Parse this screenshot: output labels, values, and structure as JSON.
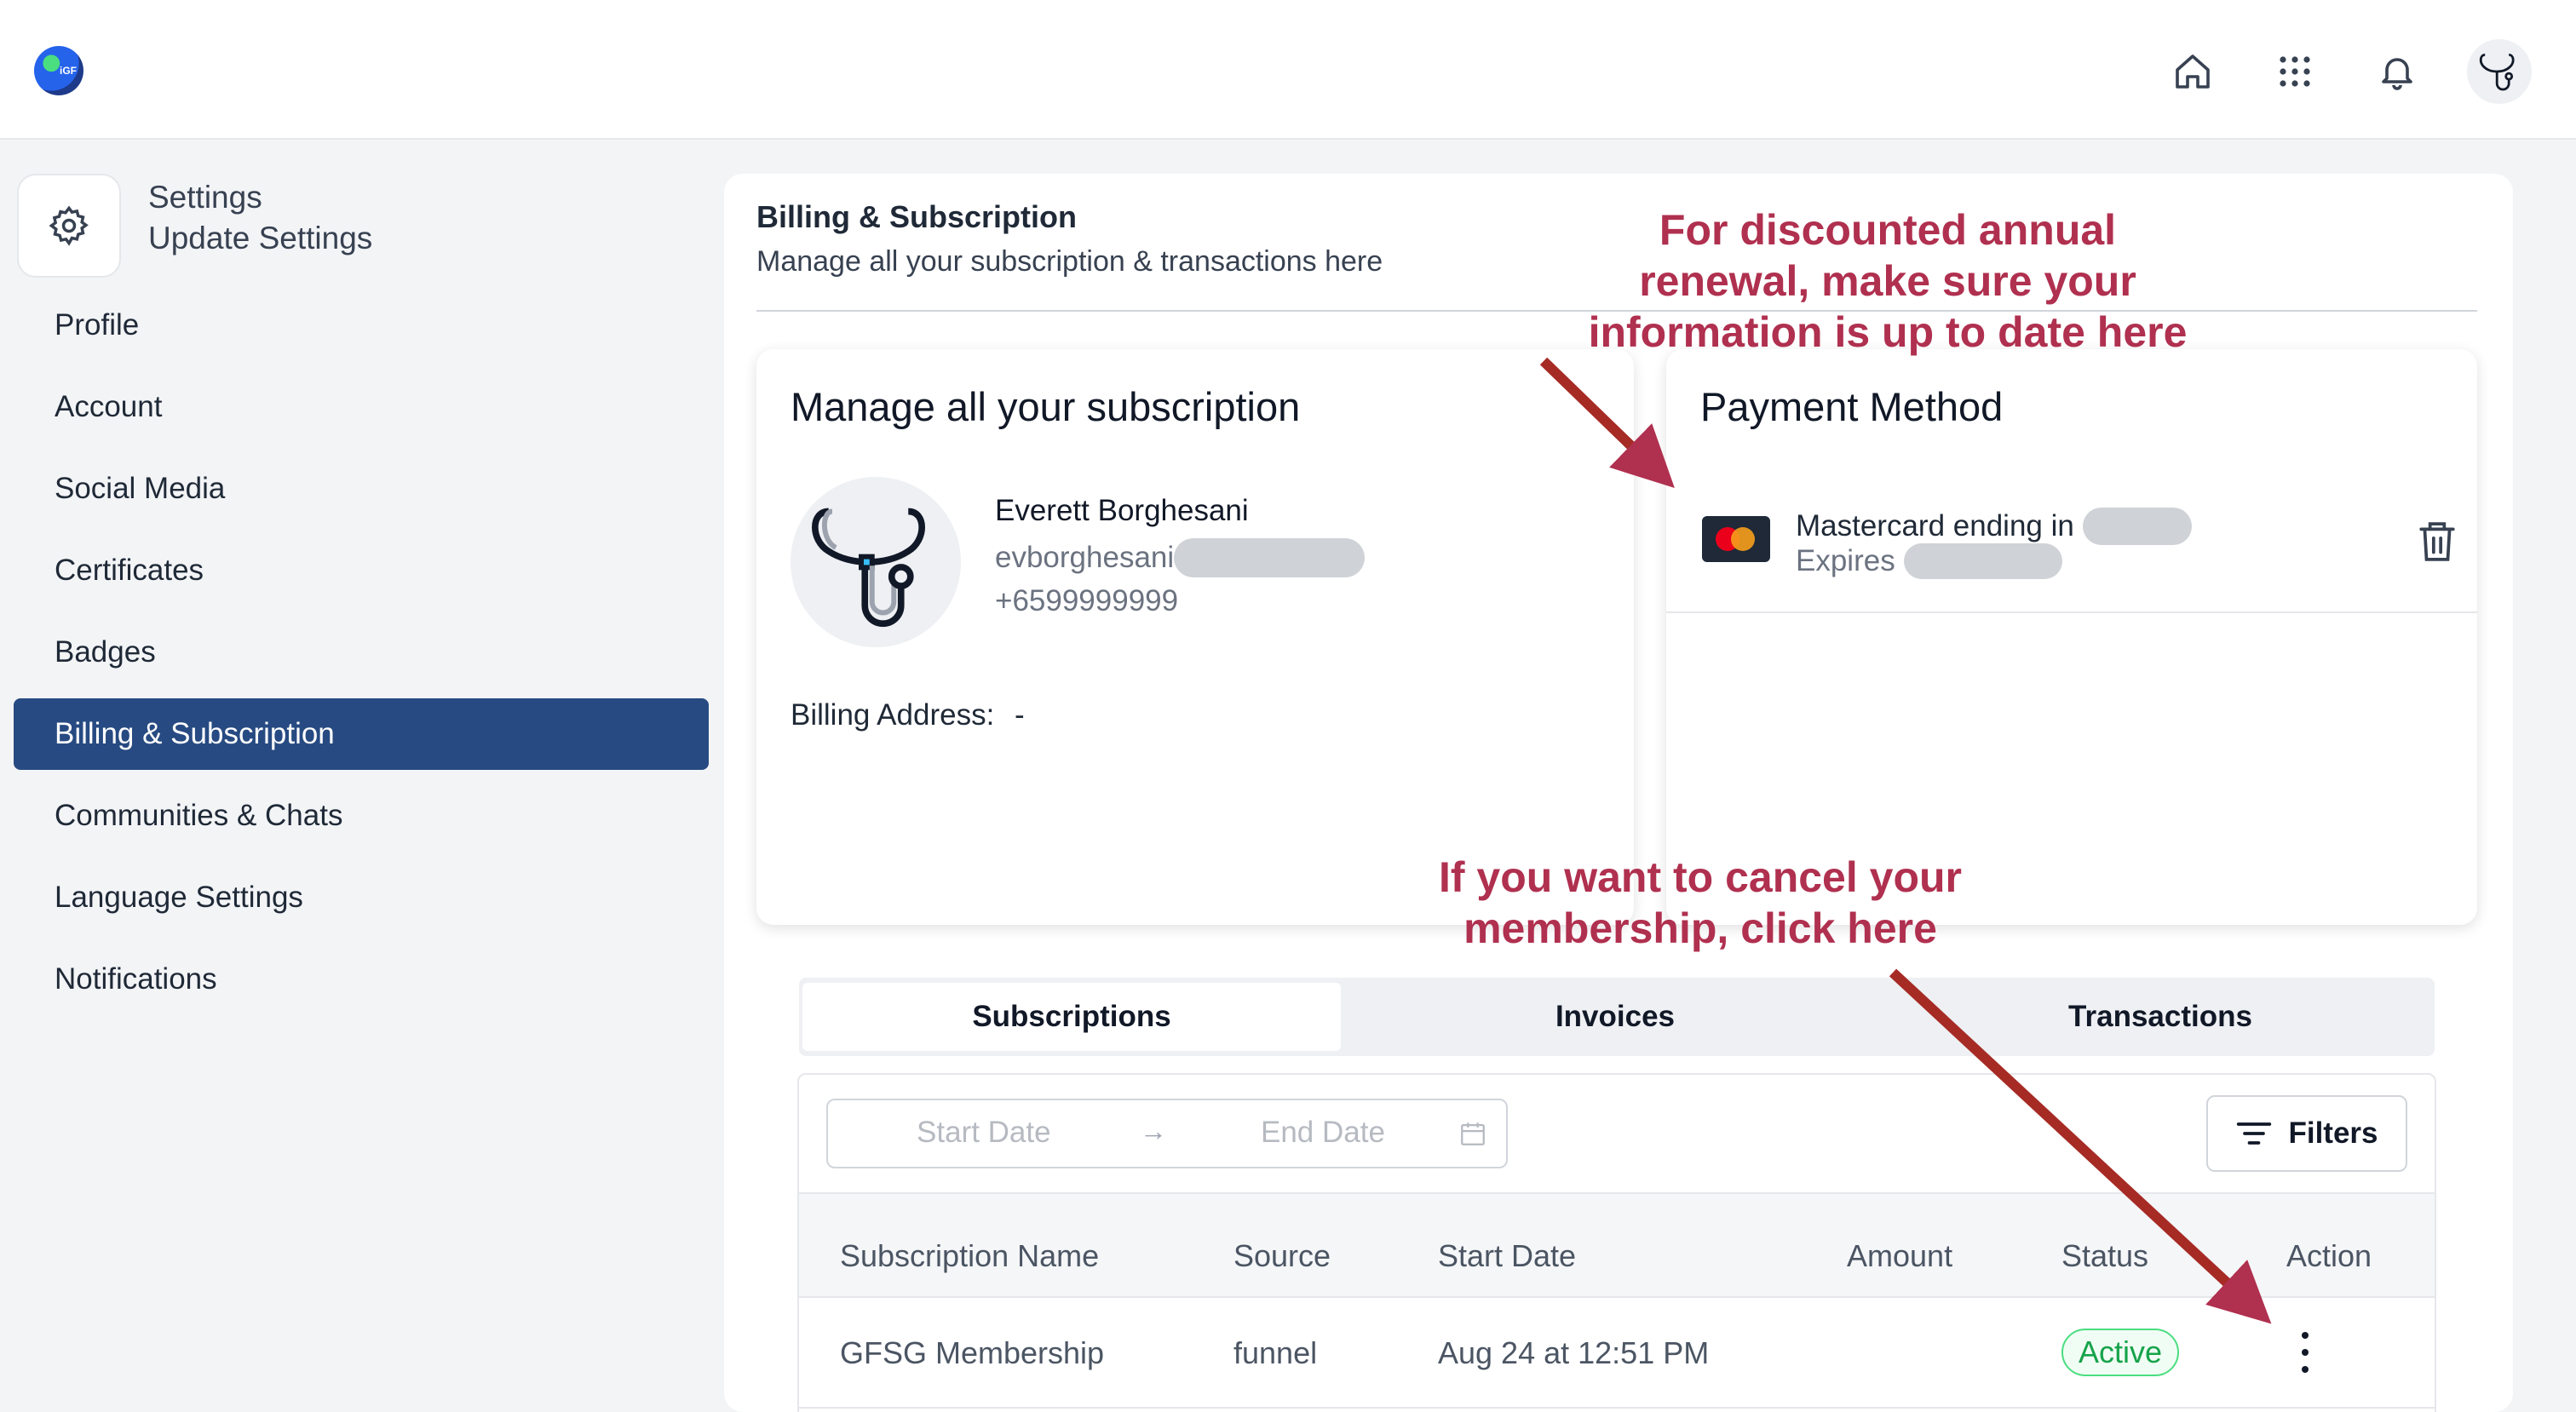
{
  "colors": {
    "accent": "#274a82",
    "annotation": "#b0304f",
    "active_status": "#16a34a"
  },
  "topbar": {
    "logo_text": "iGF",
    "icons": [
      "home-icon",
      "apps-grid-icon",
      "bell-icon",
      "user-avatar-stethoscope"
    ]
  },
  "sidebar": {
    "header_title": "Settings",
    "header_subtitle": "Update Settings",
    "items": [
      {
        "label": "Profile"
      },
      {
        "label": "Account"
      },
      {
        "label": "Social Media"
      },
      {
        "label": "Certificates"
      },
      {
        "label": "Badges"
      },
      {
        "label": "Billing & Subscription",
        "active": true
      },
      {
        "label": "Communities & Chats"
      },
      {
        "label": "Language Settings"
      },
      {
        "label": "Notifications"
      }
    ]
  },
  "main": {
    "title": "Billing & Subscription",
    "subtitle": "Manage all your subscription & transactions here"
  },
  "subscription_card": {
    "heading": "Manage all your subscription",
    "name": "Everett Borghesani",
    "email_prefix": "evborghesani",
    "phone": "+6599999999",
    "billing_address_label": "Billing Address:",
    "billing_address_value": "-"
  },
  "payment_card": {
    "heading": "Payment Method",
    "card_line": "Mastercard ending in",
    "expires_label": "Expires"
  },
  "tabs": [
    {
      "label": "Subscriptions",
      "active": true
    },
    {
      "label": "Invoices"
    },
    {
      "label": "Transactions"
    }
  ],
  "filters": {
    "start_placeholder": "Start Date",
    "end_placeholder": "End Date",
    "arrow": "→",
    "filters_label": "Filters"
  },
  "table": {
    "columns": [
      "Subscription Name",
      "Source",
      "Start Date",
      "Amount",
      "Status",
      "Action"
    ],
    "rows": [
      {
        "name": "GFSG Membership",
        "source": "funnel",
        "start_date": "Aug 24 at 12:51 PM",
        "amount": "",
        "status": "Active"
      }
    ]
  },
  "annotations": {
    "renewal": [
      "For discounted annual",
      "renewal, make sure your",
      "information is up to date here"
    ],
    "cancel": [
      "If you want to cancel your",
      "membership, click here"
    ]
  }
}
